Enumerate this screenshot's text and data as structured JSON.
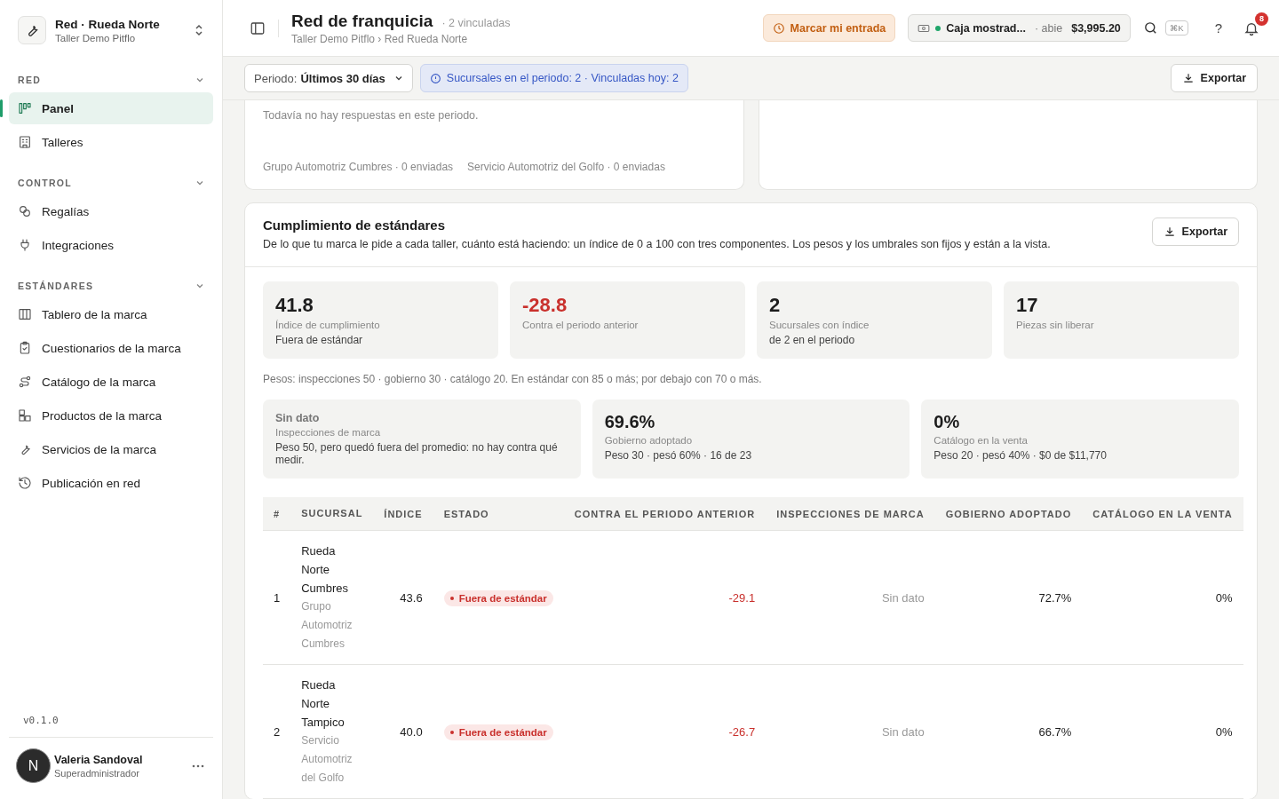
{
  "sidebar": {
    "brand": {
      "title": "Red · Rueda Norte",
      "subtitle": "Taller Demo Pitflo"
    },
    "sections": [
      {
        "title": "RED",
        "expanded": true,
        "items": [
          {
            "label": "Panel",
            "selected": true
          },
          {
            "label": "Talleres",
            "selected": false
          }
        ]
      },
      {
        "title": "CONTROL",
        "expanded": true,
        "items": [
          {
            "label": "Regalías",
            "selected": false
          },
          {
            "label": "Integraciones",
            "selected": false
          }
        ]
      },
      {
        "title": "ESTÁNDARES",
        "expanded": true,
        "items": [
          {
            "label": "Tablero de la marca",
            "selected": false
          },
          {
            "label": "Cuestionarios de la marca",
            "selected": false
          },
          {
            "label": "Catálogo de la marca",
            "selected": false
          },
          {
            "label": "Productos de la marca",
            "selected": false
          },
          {
            "label": "Servicios de la marca",
            "selected": false
          },
          {
            "label": "Publicación en red",
            "selected": false
          }
        ]
      }
    ],
    "version": "v0.1.0",
    "user": {
      "initial": "N",
      "name": "Valeria Sandoval",
      "role": "Superadministrador"
    }
  },
  "header": {
    "title": "Red de franquicia",
    "count": "· 2 vinculadas",
    "breadcrumb": "Taller Demo Pitflo › Red Rueda Norte",
    "clock_button": "Marcar mi entrada",
    "register": {
      "name": "Caja mostrad...",
      "status": "· abie",
      "amount": "$3,995.20",
      "open": true
    },
    "shortcut": "⌘K",
    "help": "?",
    "notifications": "8"
  },
  "toolbar": {
    "period_label": "Periodo:",
    "period_value": "Últimos 30 días",
    "info": "Sucursales en el periodo: 2 · Vinculadas hoy: 2",
    "export": "Exportar"
  },
  "survey_card": {
    "empty_text": "Todavía no hay respuestas en este periodo.",
    "footer": [
      "Grupo Automotriz Cumbres · 0 enviadas",
      "Servicio Automotriz del Golfo · 0 enviadas"
    ]
  },
  "compliance": {
    "title": "Cumplimiento de estándares",
    "description": "De lo que tu marca le pide a cada taller, cuánto está haciendo: un índice de 0 a 100 con tres componentes. Los pesos y los umbrales son fijos y están a la vista.",
    "export": "Exportar",
    "stats": [
      {
        "value": "41.8",
        "label": "Índice de cumplimiento",
        "note": "Fuera de estándar",
        "negative": false
      },
      {
        "value": "-28.8",
        "label": "Contra el periodo anterior",
        "negative": true
      },
      {
        "value": "2",
        "label": "Sucursales con índice",
        "note": "de 2 en el periodo",
        "negative": false
      },
      {
        "value": "17",
        "label": "Piezas sin liberar",
        "negative": false
      }
    ],
    "weights": "Pesos: inspecciones 50 · gobierno 30 · catálogo 20. En estándar con 85 o más; por debajo con 70 o más.",
    "components": [
      {
        "value": "Sin dato",
        "has_value": false,
        "label": "Inspecciones de marca",
        "detail": "Peso 50, pero quedó fuera del promedio: no hay contra qué medir."
      },
      {
        "value": "69.6%",
        "has_value": true,
        "label": "Gobierno adoptado",
        "detail": "Peso 30 · pesó 60% · 16 de 23"
      },
      {
        "value": "0%",
        "has_value": true,
        "label": "Catálogo en la venta",
        "detail": "Peso 20 · pesó 40% · $0 de $11,770"
      }
    ],
    "table": {
      "columns": [
        "#",
        "SUCURSAL",
        "ÍNDICE",
        "ESTADO",
        "CONTRA EL PERIODO ANTERIOR",
        "INSPECCIONES DE MARCA",
        "GOBIERNO ADOPTADO",
        "CATÁLOGO EN LA VENTA"
      ],
      "rows": [
        {
          "n": "1",
          "name": "Rueda Norte Cumbres",
          "group": "Grupo Automotriz Cumbres",
          "index": "43.6",
          "status": "Fuera de estándar",
          "delta": "-29.1",
          "delta_negative": true,
          "inspections": "Sin dato",
          "inspections_missing": true,
          "governance": "72.7%",
          "catalog": "0%"
        },
        {
          "n": "2",
          "name": "Rueda Norte Tampico",
          "group": "Servicio Automotriz del Golfo",
          "index": "40.0",
          "status": "Fuera de estándar",
          "delta": "-26.7",
          "delta_negative": true,
          "inspections": "Sin dato",
          "inspections_missing": true,
          "governance": "66.7%",
          "catalog": "0%"
        }
      ]
    }
  }
}
